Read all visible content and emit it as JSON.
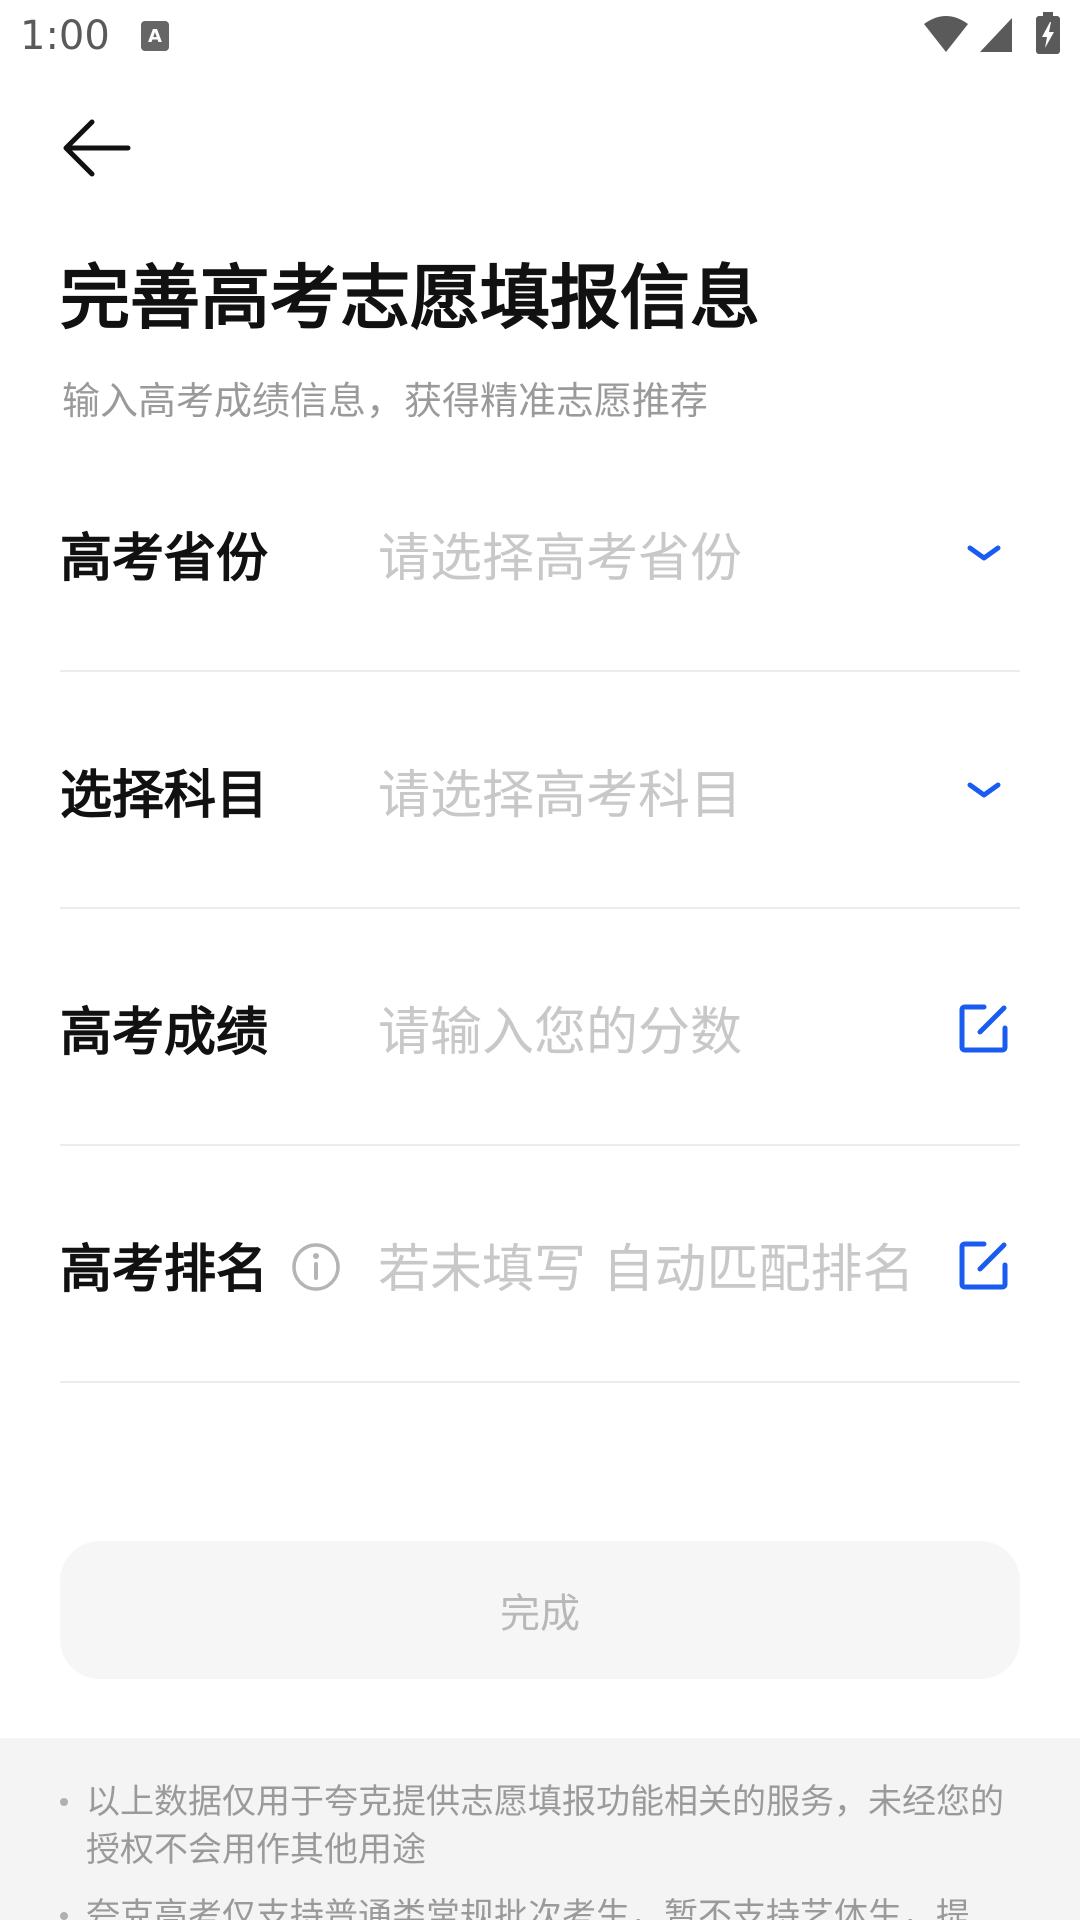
{
  "status_bar": {
    "time": "1:00"
  },
  "header": {
    "title": "完善高考志愿填报信息",
    "subtitle": "输入高考成绩信息，获得精准志愿推荐"
  },
  "form": {
    "rows": [
      {
        "label": "高考省份",
        "placeholder": "请选择高考省份",
        "icon": "chevron-down-icon"
      },
      {
        "label": "选择科目",
        "placeholder": "请选择高考科目",
        "icon": "chevron-down-icon"
      },
      {
        "label": "高考成绩",
        "placeholder": "请输入您的分数",
        "icon": "edit-icon"
      },
      {
        "label": "高考排名",
        "placeholder": "若未填写 自动匹配排名",
        "icon": "edit-icon"
      }
    ]
  },
  "actions": {
    "done_label": "完成"
  },
  "footer": {
    "notes": [
      "以上数据仅用于夸克提供志愿填报功能相关的服务，未经您的授权不会用作其他用途",
      "夸克高考仅支持普通类常规批次考生，暂不支持艺体生，提"
    ]
  },
  "colors": {
    "accent": "#1a5cf0",
    "placeholder": "#c8c8c8",
    "divider": "#ececec"
  }
}
